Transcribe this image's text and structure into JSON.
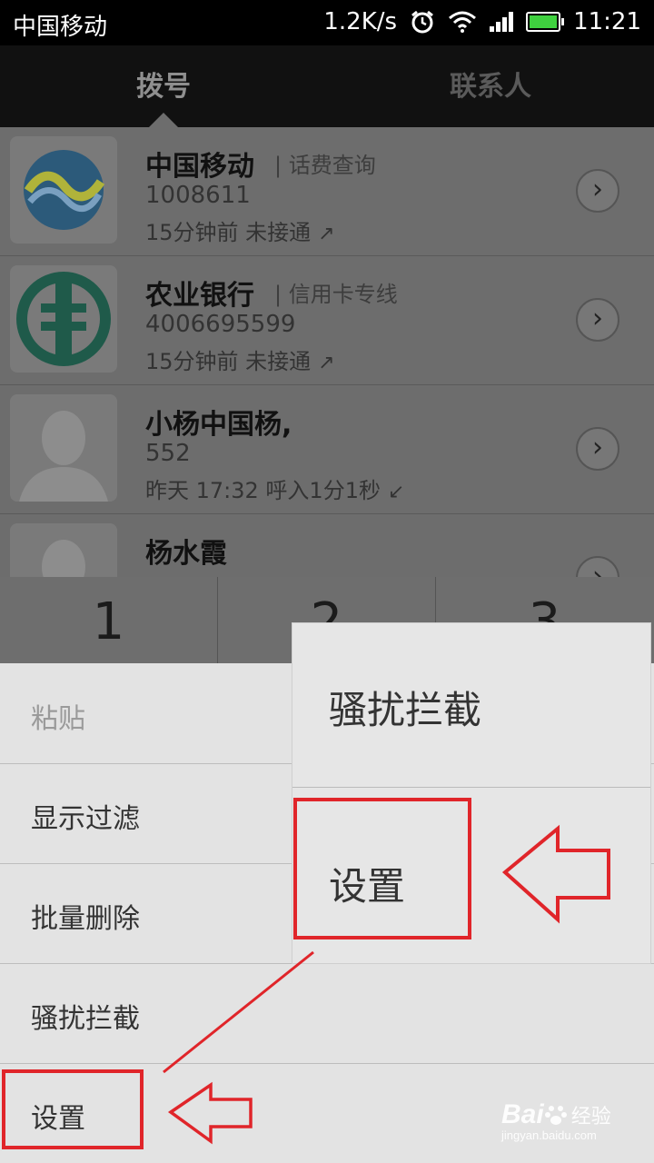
{
  "status_bar": {
    "carrier": "中国移动",
    "speed": "1.2K/s",
    "time": "11:21"
  },
  "tabs": [
    {
      "label": "拨号",
      "active": true
    },
    {
      "label": "联系人",
      "active": false
    }
  ],
  "call_log": [
    {
      "name": "中国移动",
      "tag": "话费查询",
      "number": "1008611",
      "time": "15分钟前 未接通",
      "direction_icon": "outgoing-arrow-icon",
      "avatar_icon": "china-mobile-logo-icon"
    },
    {
      "name": "农业银行",
      "tag": "信用卡专线",
      "number": "4006695599",
      "time": "15分钟前 未接通",
      "direction_icon": "outgoing-arrow-icon",
      "avatar_icon": "abc-bank-logo-icon"
    },
    {
      "name": "小杨中国杨,",
      "tag": "",
      "number": "552",
      "time": "昨天 17:32 呼入1分1秒",
      "direction_icon": "incoming-arrow-icon",
      "avatar_icon": "default-person-icon"
    },
    {
      "name": "杨水霞",
      "tag": "",
      "number": "",
      "time": "",
      "direction_icon": "",
      "avatar_icon": "default-person-icon"
    }
  ],
  "keypad": [
    {
      "digit": "1"
    },
    {
      "digit": "2"
    },
    {
      "digit": "3"
    }
  ],
  "menu": {
    "items": [
      {
        "label": "粘贴",
        "enabled": false
      },
      {
        "label": "显示过滤",
        "enabled": true
      },
      {
        "label": "批量删除",
        "enabled": true
      },
      {
        "label": "骚扰拦截",
        "enabled": true
      },
      {
        "label": "设置",
        "enabled": true
      }
    ]
  },
  "zoom_callout": {
    "item_top": "骚扰拦截",
    "item_bottom": "设置"
  },
  "watermark": {
    "brand": "Bai",
    "brand_suffix": "经验",
    "url": "jingyan.baidu.com"
  },
  "colors": {
    "highlight": "#e0252a",
    "battery": "#3fd13f"
  }
}
